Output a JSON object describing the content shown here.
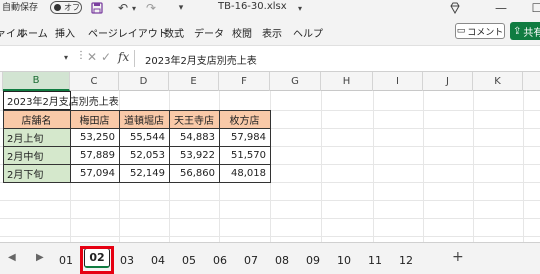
{
  "titlebar": {
    "autosave_label": "自動保存",
    "autosave_toggle": "オフ",
    "filename": "TB-16-30.xlsx",
    "icons": [
      "save-icon",
      "undo-icon",
      "redo-icon",
      "diamond-icon",
      "minimize-icon",
      "maximize-icon"
    ]
  },
  "menu": {
    "items": [
      "ファイル",
      "ホーム",
      "挿入",
      "ページレイアウト",
      "数式",
      "データ",
      "校閲",
      "表示",
      "ヘルプ"
    ],
    "comment_label": "コメント",
    "share_label": "共有"
  },
  "formula_bar": {
    "fx_label": "fx",
    "content": "2023年2月支店別売上表"
  },
  "grid": {
    "column_headers": [
      "B",
      "C",
      "D",
      "E",
      "F",
      "G",
      "H",
      "I",
      "J",
      "K"
    ],
    "selected_column": "B",
    "title": "2023年2月支店別売上表",
    "table_headers": [
      "店舗名",
      "梅田店",
      "道頓堀店",
      "天王寺店",
      "枚方店"
    ],
    "rows": [
      {
        "label": "2月上旬",
        "values": [
          "53,250",
          "55,544",
          "54,883",
          "57,984"
        ]
      },
      {
        "label": "2月中旬",
        "values": [
          "57,889",
          "52,053",
          "53,922",
          "51,570"
        ]
      },
      {
        "label": "2月下旬",
        "values": [
          "57,094",
          "52,149",
          "56,860",
          "48,018"
        ]
      }
    ]
  },
  "sheet_tabs": {
    "tabs": [
      "01",
      "02",
      "03",
      "04",
      "05",
      "06",
      "07",
      "08",
      "09",
      "10",
      "11",
      "12"
    ],
    "active": "02",
    "add_label": "+",
    "highlight_color": "#e60012"
  },
  "colors": {
    "header_fill": "#f9c9a8",
    "label_fill": "#d5e8cc",
    "accent": "#107c41"
  }
}
